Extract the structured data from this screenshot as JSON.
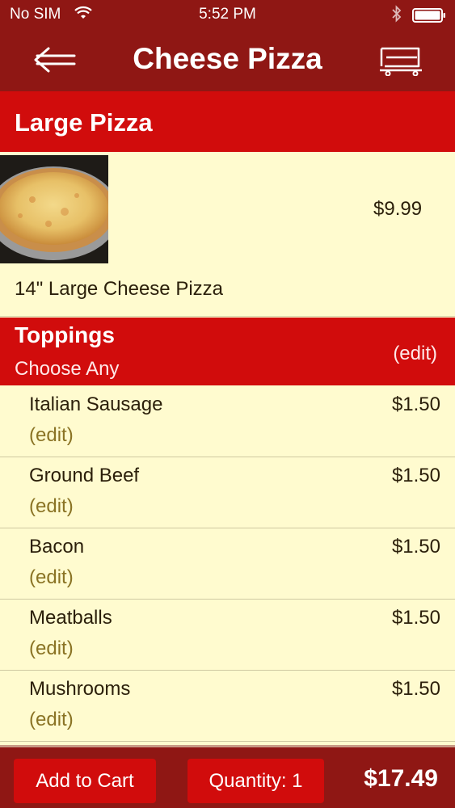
{
  "status_bar": {
    "carrier": "No SIM",
    "time": "5:52 PM"
  },
  "nav": {
    "title": "Cheese Pizza",
    "back_icon": "back-arrow-icon",
    "cart_icon": "cart-icon"
  },
  "size": {
    "label": "Large Pizza"
  },
  "product": {
    "price": "$9.99",
    "description": "14\" Large Cheese Pizza"
  },
  "toppings": {
    "title": "Toppings",
    "subtitle": "Choose Any",
    "edit_label": "(edit)",
    "items": [
      {
        "name": "Italian Sausage",
        "price": "$1.50",
        "edit": "(edit)"
      },
      {
        "name": "Ground Beef",
        "price": "$1.50",
        "edit": "(edit)"
      },
      {
        "name": "Bacon",
        "price": "$1.50",
        "edit": "(edit)"
      },
      {
        "name": "Meatballs",
        "price": "$1.50",
        "edit": "(edit)"
      },
      {
        "name": "Mushrooms",
        "price": "$1.50",
        "edit": "(edit)"
      }
    ]
  },
  "bottom": {
    "add_to_cart": "Add to Cart",
    "quantity": "Quantity: 1",
    "total": "$17.49"
  },
  "colors": {
    "nav_bg": "#8f1714",
    "header_bg": "#d10c0c",
    "page_bg": "#fffbcf",
    "edit_text": "#8a7324"
  }
}
